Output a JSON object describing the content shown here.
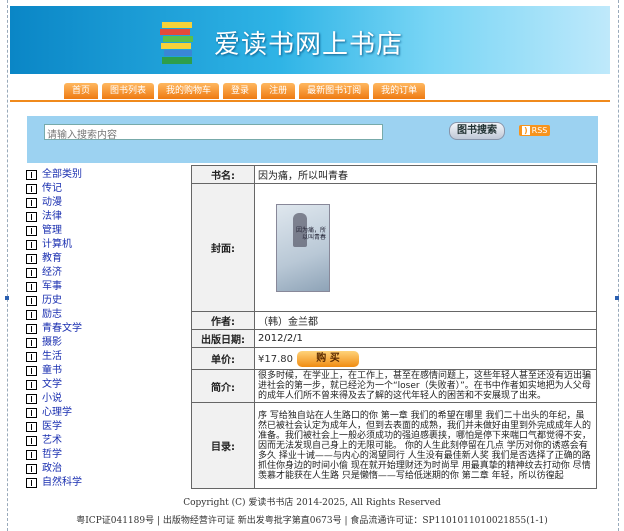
{
  "site": {
    "title": "爱读书网上书店"
  },
  "nav": [
    "首页",
    "图书列表",
    "我的购物车",
    "登录",
    "注册",
    "最新图书订阅",
    "我的订单"
  ],
  "search": {
    "placeholder": "请输入搜索内容",
    "button": "图书搜索",
    "rss": "RSS"
  },
  "categories": [
    "全部类别",
    "传记",
    "动漫",
    "法律",
    "管理",
    "计算机",
    "教育",
    "经济",
    "军事",
    "历史",
    "励志",
    "青春文学",
    "摄影",
    "生活",
    "童书",
    "文学",
    "小说",
    "心理学",
    "医学",
    "艺术",
    "哲学",
    "政治",
    "自然科学"
  ],
  "book": {
    "labels": {
      "name": "书名:",
      "cover": "封面:",
      "author": "作者:",
      "date": "出版日期:",
      "price": "单价:",
      "summary": "简介:",
      "toc": "目录:"
    },
    "name": "因为痛，所以叫青春",
    "author": "（韩）金兰都",
    "date": "2012/2/1",
    "price": "¥17.80",
    "buy": "购 买",
    "summary": "很多时候，在学业上，在工作上，甚至在感情问题上，这些年轻人甚至还没有迈出骗进社会的第一步，就已经沦为一个“loser（失败者）”。在书中作者如实地把为人父母的成年人们所不曾来得及去了解的这代年轻人的困苦和不安展现了出来。",
    "toc": "序 写给独自站在人生路口的你 第一章 我们的希望在哪里      我们二十出头的年纪，虽然已被社会认定为成年人，但到去表面的成熟，我们并未做好由里到外完成成年人的准备。我们被社会上一般必须成功的强迫感裹挟，哪怕是停下来喘口气都觉得不安，因而无法发现自己身上的无限可能。    你的人生此刻停留在几点    学历对你的诱惑会有多久    择业十诫——与内心的渴望同行    人生没有最佳新人奖 我们是否选择了正确的路    抓住你身边的时间小偷    现在就开始理财还为时尚早 用最真挚的精神纹去打动你    尽情羡慕才能获在人生路    只是懒惰——写给低迷期的你 第二章 年轻，所以彷徨起",
    "cover_text": "因为痛，所以叫青春"
  },
  "footer": {
    "line1": "Copyright (C) 爱读书书店 2014-2025, All Rights Reserved",
    "line2": "粤ICP证041189号 | 出版物经营许可证 新出发粤批字第直0673号 | 食品流通许可证：SP1101011010021855(1-1)"
  }
}
